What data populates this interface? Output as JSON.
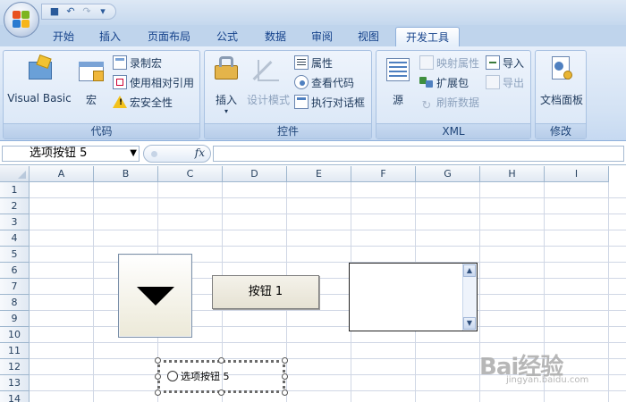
{
  "quick_access": {
    "icons": [
      "save-icon",
      "undo-icon",
      "redo-icon",
      "customize-dropdown-icon"
    ]
  },
  "tabs": [
    "开始",
    "插入",
    "页面布局",
    "公式",
    "数据",
    "审阅",
    "视图",
    "开发工具"
  ],
  "active_tab": "开发工具",
  "ribbon": {
    "code": {
      "label": "代码",
      "visual_basic": "Visual Basic",
      "macros": "宏",
      "record_macro": "录制宏",
      "relative_refs": "使用相对引用",
      "macro_security": "宏安全性"
    },
    "controls": {
      "label": "控件",
      "insert": "插入",
      "design_mode": "设计模式",
      "properties": "属性",
      "view_code": "查看代码",
      "run_dialog": "执行对话框"
    },
    "xml": {
      "label": "XML",
      "source": "源",
      "map_properties": "映射属性",
      "expansion_packs": "扩展包",
      "refresh_data": "刷新数据",
      "import": "导入",
      "export": "导出"
    },
    "modify": {
      "label": "修改",
      "document_panel": "文档面板"
    }
  },
  "formula_bar": {
    "name_box": "选项按钮 5",
    "fx": "fx",
    "formula": ""
  },
  "sheet": {
    "columns": [
      "A",
      "B",
      "C",
      "D",
      "E",
      "F",
      "G",
      "H",
      "I"
    ],
    "rows": [
      "1",
      "2",
      "3",
      "4",
      "5",
      "6",
      "7",
      "8",
      "9",
      "10",
      "11",
      "12",
      "13",
      "14"
    ]
  },
  "form_controls": {
    "button_label": "按钮 1",
    "option_button_label": "选项按钮 5"
  },
  "watermark": {
    "text": "Bai经验",
    "sub": "jingyan.baidu.com"
  }
}
